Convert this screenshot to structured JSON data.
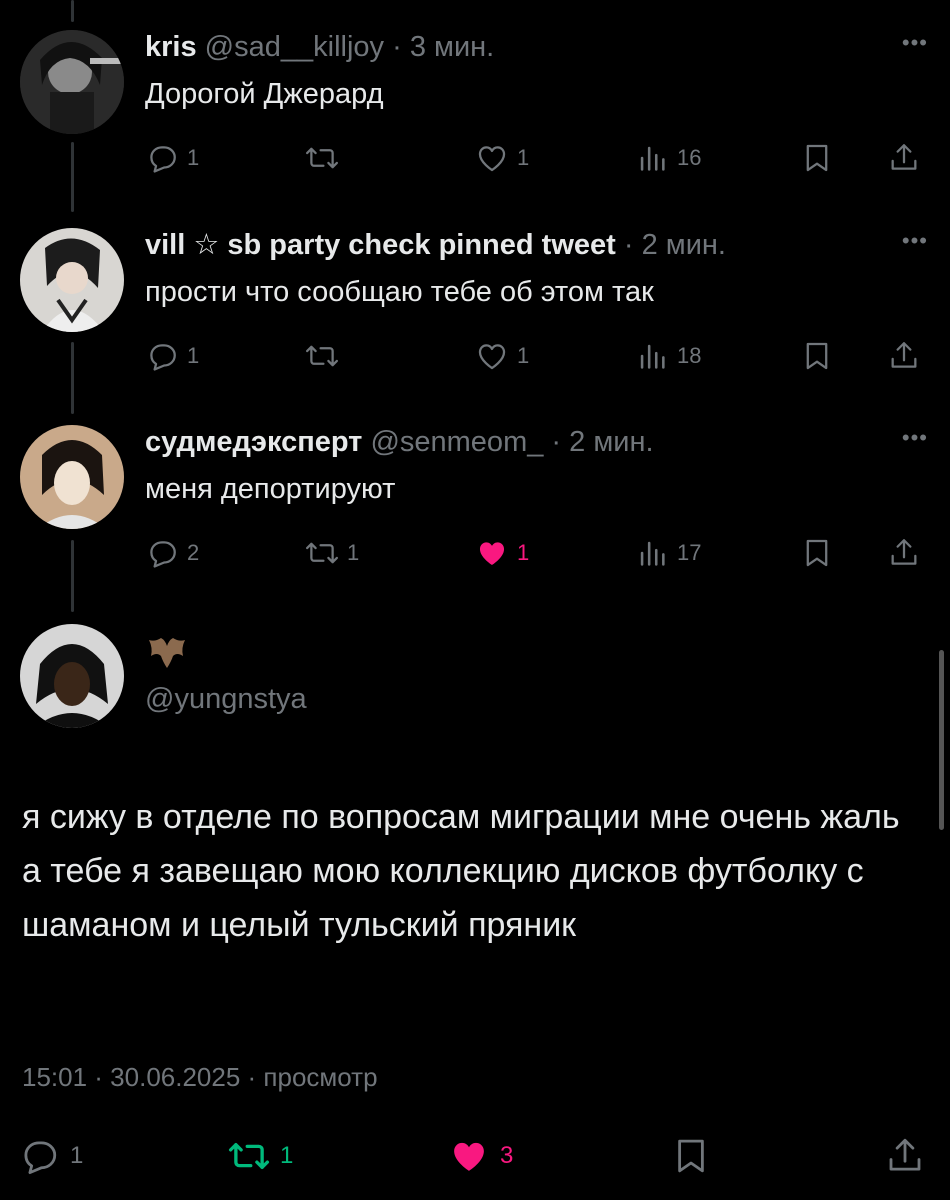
{
  "replies": [
    {
      "name": "kris",
      "handle": "@sad__killjoy",
      "separator": "·",
      "time": "3 мин.",
      "text": "Дорогой Джерард",
      "reply_count": "1",
      "retweet_count": "",
      "like_count": "1",
      "view_count": "16",
      "liked": false,
      "retweeted": false
    },
    {
      "name": "vill ☆ sb party check pinned tweet",
      "handle": "",
      "separator": "·",
      "time": "2 мин.",
      "text": "прости что сообщаю тебе об этом так",
      "reply_count": "1",
      "retweet_count": "",
      "like_count": "1",
      "view_count": "18",
      "liked": false,
      "retweeted": false
    },
    {
      "name": "судмедэксперт",
      "handle": "@senmeom_",
      "separator": "·",
      "time": "2 мин.",
      "text": "меня депортируют",
      "reply_count": "2",
      "retweet_count": "1",
      "like_count": "1",
      "view_count": "17",
      "liked": true,
      "retweeted": false
    }
  ],
  "more_label": "•••",
  "main": {
    "emoji_icon": "bat-icon",
    "handle": "@yungnstya",
    "text": "я сижу в отделе по вопросам миграции мне очень жаль а тебе я завещаю мою коллекцию дисков футболку с шаманом и целый тульский пряник",
    "meta": "15:01 · 30.06.2025 · просмотр",
    "reply_count": "1",
    "retweet_count": "1",
    "like_count": "3"
  },
  "colors": {
    "background": "#000000",
    "text": "#e7e9ea",
    "muted": "#71767b",
    "like_active": "#f91880",
    "retweet_active": "#00ba7c",
    "thread_line": "#2f3336"
  }
}
